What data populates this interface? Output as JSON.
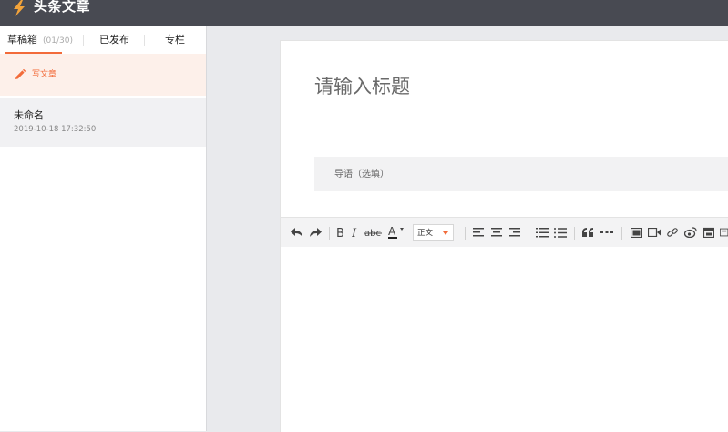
{
  "header": {
    "app_title": "头条文章",
    "logo_icon": "lightning-icon",
    "background": "#484a52"
  },
  "sidebar": {
    "tabs": [
      {
        "label": "草稿箱",
        "count": "(01/30)",
        "active": true
      },
      {
        "label": "已发布"
      },
      {
        "label": "专栏"
      }
    ],
    "write_action": {
      "label": "写文章",
      "icon": "pencil-icon"
    },
    "drafts": [
      {
        "title": "未命名",
        "time": "2019-10-18 17:32:50"
      }
    ]
  },
  "editor": {
    "title_placeholder": "请输入标题",
    "intro_placeholder": "导语（选填）",
    "font_select": "正文",
    "toolbar_icons": [
      "undo-icon",
      "redo-icon",
      "bold-icon",
      "italic-icon",
      "strikethrough-icon",
      "font-color-icon",
      "paragraph-format-select",
      "align-left-icon",
      "align-center-icon",
      "align-right-icon",
      "ordered-list-icon",
      "unordered-list-icon",
      "blockquote-icon",
      "horizontal-rule-icon",
      "image-icon",
      "video-icon",
      "link-icon",
      "weibo-icon",
      "calendar-icon",
      "more-icon"
    ]
  },
  "colors": {
    "accent": "#f26b3a",
    "active_bg": "#fdf0ea",
    "page_bg": "#e9eaed"
  }
}
